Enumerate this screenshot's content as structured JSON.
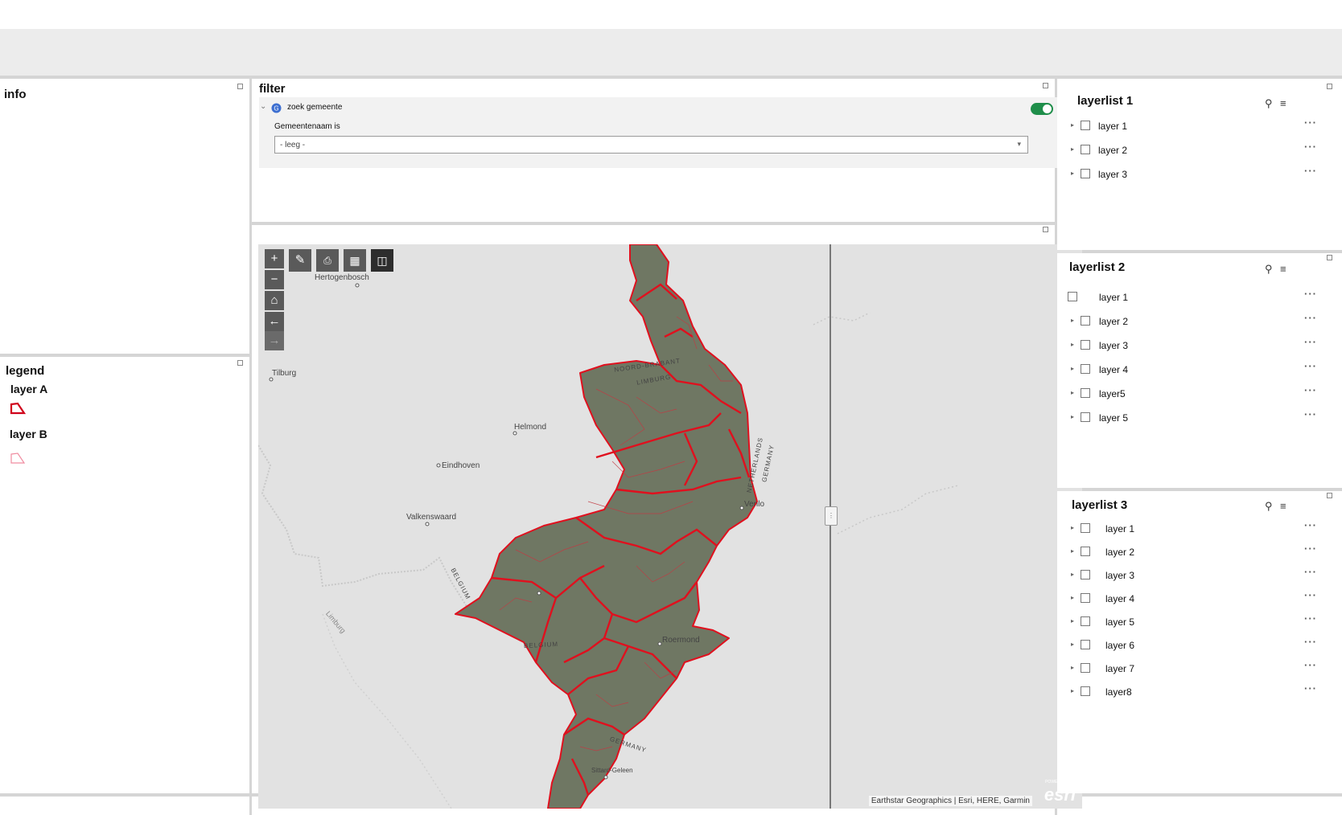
{
  "info": {
    "title": "info"
  },
  "legend": {
    "title": "legend",
    "items": [
      {
        "label": "layer A",
        "color": "#d0021b"
      },
      {
        "label": "layer B",
        "color": "#f08ca0"
      }
    ]
  },
  "filter": {
    "title": "filter",
    "group_label": "zoek gemeente",
    "field_label": "Gemeentenaam is",
    "select_value": "- leeg -",
    "toggle_color": "#1f8e4a"
  },
  "map": {
    "places": [
      "Hertogenbosch",
      "Tilburg",
      "Helmond",
      "Eindhoven",
      "Valkenswaard",
      "NOORD-BRABANT",
      "LIMBURG",
      "NETHERLANDS",
      "GERMANY",
      "Venlo",
      "BELGIUM",
      "BELGIUM",
      "Roermond",
      "Limburg",
      "GERMANY",
      "Sittard-Geleen"
    ],
    "attribution": "Earthstar Geographics | Esri, HERE, Garmin",
    "logo": "esri",
    "powered": "POWERED BY",
    "boundary_color": "#e0101e"
  },
  "layerlist1": {
    "title": "layerlist 1",
    "items": [
      "layer 1",
      "layer 2",
      "layer 3"
    ]
  },
  "layerlist2": {
    "title": "layerlist 2",
    "items": [
      "layer 1",
      "layer 2",
      "layer 3",
      "layer 4",
      "layer5",
      "layer 5"
    ]
  },
  "layerlist3": {
    "title": "layerlist 3",
    "items": [
      "layer 1",
      "layer 2",
      "layer 3",
      "layer 4",
      "layer 5",
      "layer 6",
      "layer 7",
      "layer8"
    ]
  }
}
